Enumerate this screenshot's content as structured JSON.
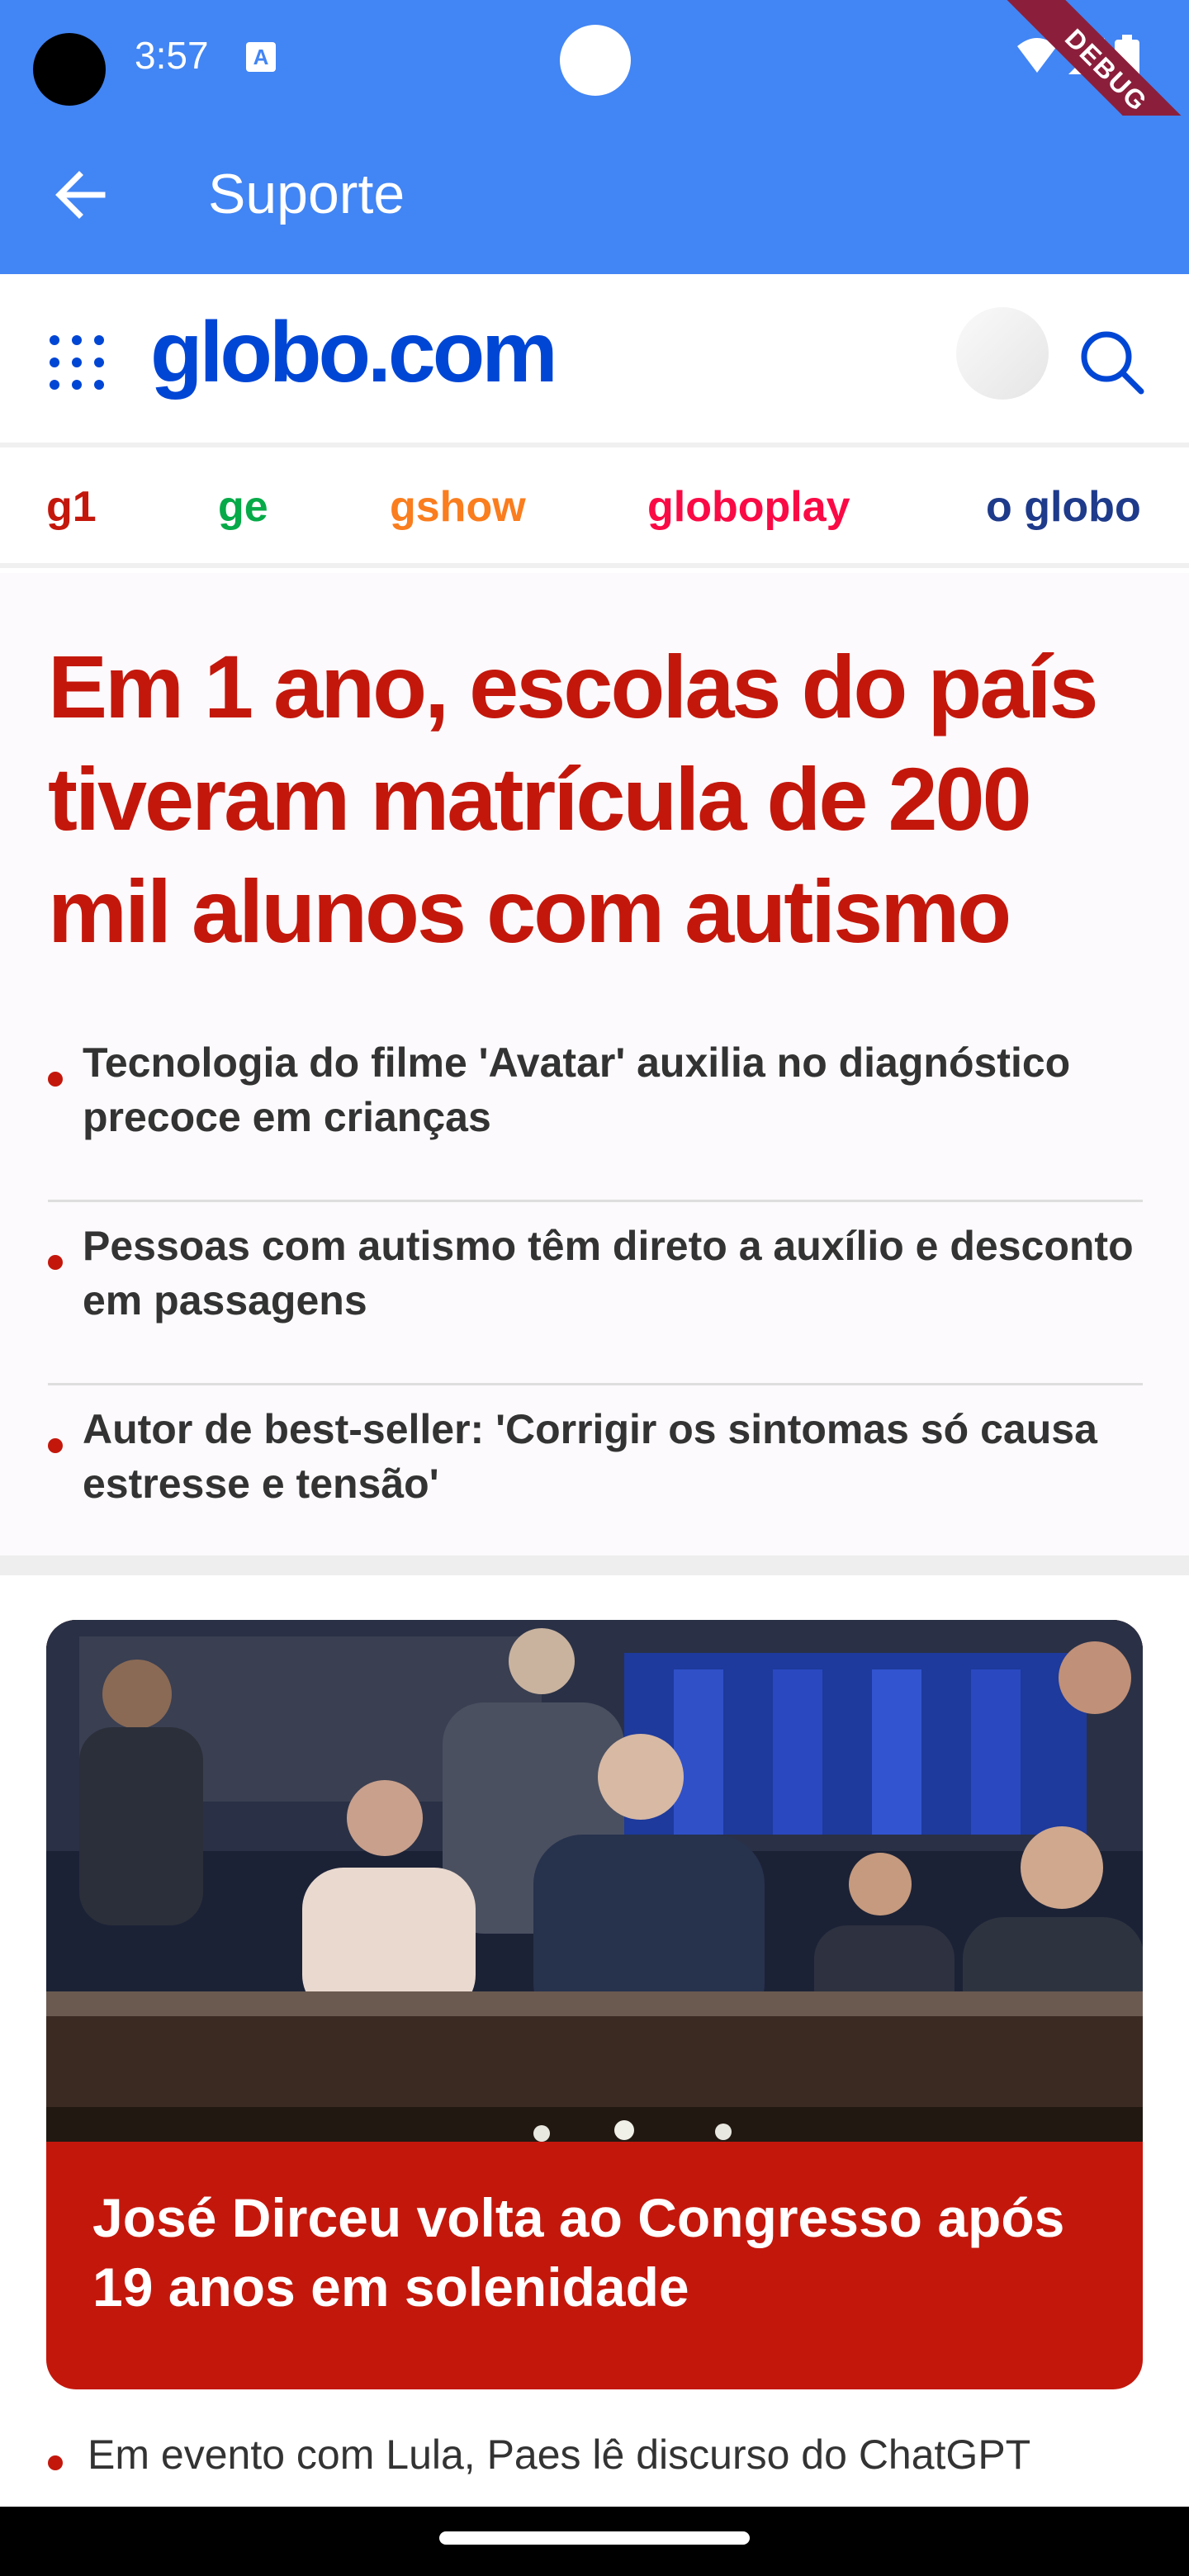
{
  "status_bar": {
    "time": "3:57",
    "debug_label": "DEBUG",
    "notification_icon": "a-icon",
    "icons": [
      "wifi-icon",
      "signal-icon",
      "battery-icon"
    ]
  },
  "app_bar": {
    "title": "Suporte",
    "back_icon": "arrow-left-icon",
    "background": "#4285f4"
  },
  "globo_header": {
    "logo": "globo.com",
    "menu_icon": "grid-menu-icon",
    "search_icon": "search-icon",
    "logo_color": "#0046d5"
  },
  "product_nav": [
    {
      "label": "g1",
      "color": "#c4170c"
    },
    {
      "label": "ge",
      "color": "#06aa48"
    },
    {
      "label": "gshow",
      "color": "#fa7d1e"
    },
    {
      "label": "globoplay",
      "color": "#fa0a45"
    },
    {
      "label": "o globo",
      "color": "#1e3a8a"
    }
  ],
  "main_story": {
    "headline": "Em 1 ano, escolas do país tiveram matrícula de 200 mil alunos com autismo",
    "related": [
      "Tecnologia do filme 'Avatar' auxilia no diagnóstico precoce em crianças",
      "Pessoas com autismo têm direto a auxílio e desconto em passagens",
      "Autor de best-seller: 'Corrigir os sintomas só causa estresse e tensão'"
    ],
    "accent_color": "#c4170c"
  },
  "card": {
    "title": "José Dirceu volta ao Congresso após 19 anos em solenidade",
    "image_description_icon": "photo-senate-session",
    "background": "#c4170c"
  },
  "sub_links": [
    "Em evento com Lula, Paes lê discurso do ChatGPT"
  ]
}
